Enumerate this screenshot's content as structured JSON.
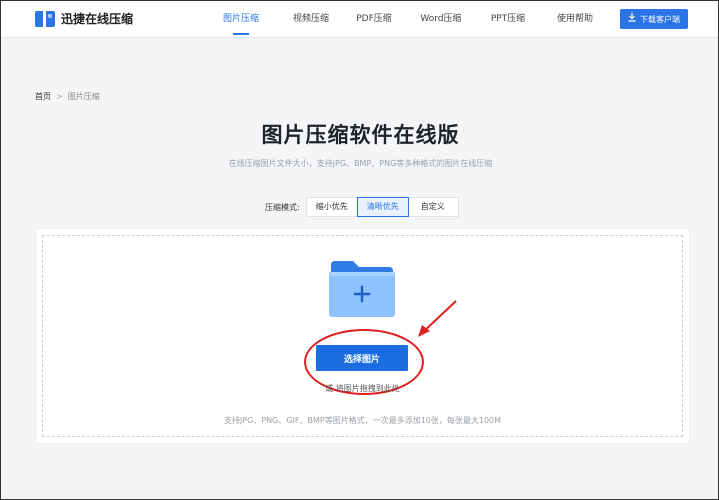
{
  "header": {
    "logo_text": "迅捷在线压缩",
    "nav": [
      {
        "label": "图片压缩",
        "active": true
      },
      {
        "label": "视频压缩",
        "active": false
      },
      {
        "label": "PDF压缩",
        "active": false
      },
      {
        "label": "Word压缩",
        "active": false
      },
      {
        "label": "PPT压缩",
        "active": false
      },
      {
        "label": "使用帮助",
        "active": false
      }
    ],
    "download_label": "下载客户端"
  },
  "breadcrumb": {
    "home": "首页",
    "separator": ">",
    "current": "图片压缩"
  },
  "main": {
    "title": "图片压缩软件在线版",
    "subtitle": "在线压缩图片文件大小，支持JPG、BMP、PNG等多种格式的图片在线压缩",
    "mode": {
      "label": "压缩模式:",
      "options": [
        "缩小优先",
        "清晰优先",
        "自定义"
      ],
      "selected": "清晰优先"
    },
    "upload": {
      "select_label": "选择图片",
      "or_text": "或 将图片拖拽到此处",
      "formats_text": "支持JPG、PNG、GIF、BMP等图片格式，一次最多添加10张，每张最大100M"
    }
  },
  "colors": {
    "accent": "#2a74e5",
    "annotation": "#e02020",
    "folder_back": "#2f7ee8",
    "folder_front": "#8ec3ff"
  }
}
